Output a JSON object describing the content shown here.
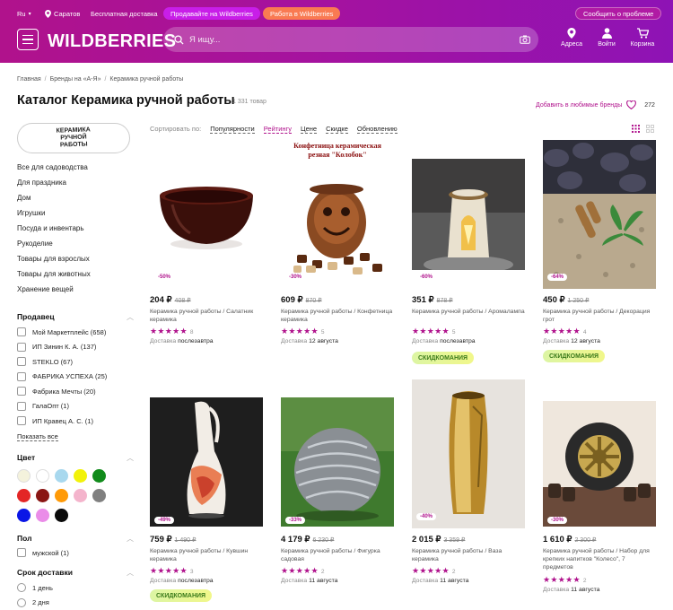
{
  "header": {
    "lang": "Ru",
    "city": "Саратов",
    "free_delivery": "Бесплатная доставка",
    "sell_button": "Продавайте на Wildberries",
    "work_button": "Работа в Wildberries",
    "report_button": "Сообщить о проблеме",
    "logo": "WILDBERRIES",
    "search_placeholder": "Я ищу...",
    "nav": [
      {
        "label": "Адреса",
        "icon": "map-pin-icon"
      },
      {
        "label": "Войти",
        "icon": "user-icon"
      },
      {
        "label": "Корзина",
        "icon": "cart-icon"
      }
    ],
    "colors": {
      "gradient_start": "#b0128c",
      "gradient_end": "#8e13b5",
      "sell": "#c81ee8",
      "work": "#f97a52"
    }
  },
  "breadcrumbs": [
    "Главная",
    "Бренды на «А-Я»",
    "Керамика ручной работы"
  ],
  "page": {
    "title": "Каталог Керамика ручной работы",
    "count": "1 331 товар",
    "add_favorite": "Добавить в любимые бренды",
    "favorite_count": "272"
  },
  "brand_logo_text": "КЕРАМИКА РУЧНОЙ РАБОТЫ",
  "categories": [
    "Все для садоводства",
    "Для праздника",
    "Дом",
    "Игрушки",
    "Посуда и инвентарь",
    "Рукоделие",
    "Товары для взрослых",
    "Товары для животных",
    "Хранение вещей"
  ],
  "filters": {
    "seller": {
      "title": "Продавец",
      "items": [
        "Мой Маркетплейс (658)",
        "ИП Зинин К. А. (137)",
        "STEKLO (67)",
        "ФАБРИКА УСПЕХА (25)",
        "Фабрика Мечты (20)",
        "ГалаОпт (1)",
        "ИП Кравец А. С. (1)"
      ],
      "show_all": "Показать все"
    },
    "color": {
      "title": "Цвет",
      "swatches": [
        "#f4f2dc",
        "#ffffff",
        "#a8d8ee",
        "#f2f20a",
        "#118b1b",
        "#e32626",
        "#8a1614",
        "#ff9a07",
        "#f4b4cc",
        "#808080",
        "#0a16e6",
        "#ea8ce8",
        "#0a0a0a"
      ]
    },
    "floor": {
      "title": "Пол",
      "items": [
        "мужской (1)"
      ]
    },
    "delivery": {
      "title": "Срок доставки",
      "items": [
        "1 день",
        "2 дня"
      ]
    }
  },
  "sort": {
    "label": "Сортировать по:",
    "options": [
      "Популярности",
      "Рейтингу",
      "Цене",
      "Скидке",
      "Обновлению"
    ],
    "active": "Рейтингу"
  },
  "products": [
    {
      "discount": "-50%",
      "price": "204 ₽",
      "old_price": "408 ₽",
      "name": "Керамика ручной работы / Салатник керамика",
      "rating_count": "8",
      "delivery_label": "Доставка",
      "delivery": "послезавтра",
      "badge": ""
    },
    {
      "discount": "-30%",
      "price": "609 ₽",
      "old_price": "870 ₽",
      "name": "Керамика ручной работы / Конфетница керамика",
      "rating_count": "5",
      "delivery_label": "Доставка",
      "delivery": "12 августа",
      "badge": "",
      "image_caption": "Конфетница керамическая резная \"Колобок\""
    },
    {
      "discount": "-60%",
      "price": "351 ₽",
      "old_price": "878 ₽",
      "name": "Керамика ручной работы / Аромалампа",
      "rating_count": "5",
      "delivery_label": "Доставка",
      "delivery": "послезавтра",
      "badge": "СКИДКОМАНИЯ"
    },
    {
      "discount": "-64%",
      "price": "450 ₽",
      "old_price": "1 250 ₽",
      "name": "Керамика ручной работы / Декорация грот",
      "rating_count": "4",
      "delivery_label": "Доставка",
      "delivery": "12 августа",
      "badge": "СКИДКОМАНИЯ"
    },
    {
      "discount": "-49%",
      "price": "759 ₽",
      "old_price": "1 490 ₽",
      "name": "Керамика ручной работы / Кувшин керамика",
      "rating_count": "3",
      "delivery_label": "Доставка",
      "delivery": "послезавтра",
      "badge": "СКИДКОМАНИЯ"
    },
    {
      "discount": "-33%",
      "price": "4 179 ₽",
      "old_price": "6 230 ₽",
      "name": "Керамика ручной работы / Фигурка садовая",
      "rating_count": "2",
      "delivery_label": "Доставка",
      "delivery": "11 августа",
      "badge": ""
    },
    {
      "discount": "-40%",
      "price": "2 015 ₽",
      "old_price": "3 359 ₽",
      "name": "Керамика ручной работы / Ваза керамика",
      "rating_count": "2",
      "delivery_label": "Доставка",
      "delivery": "11 августа",
      "badge": ""
    },
    {
      "discount": "-30%",
      "price": "1 610 ₽",
      "old_price": "2 300 ₽",
      "name": "Керамика ручной работы / Набор для крепких напитков \"Колесо\", 7 предметов",
      "rating_count": "2",
      "delivery_label": "Доставка",
      "delivery": "11 августа",
      "badge": ""
    }
  ]
}
